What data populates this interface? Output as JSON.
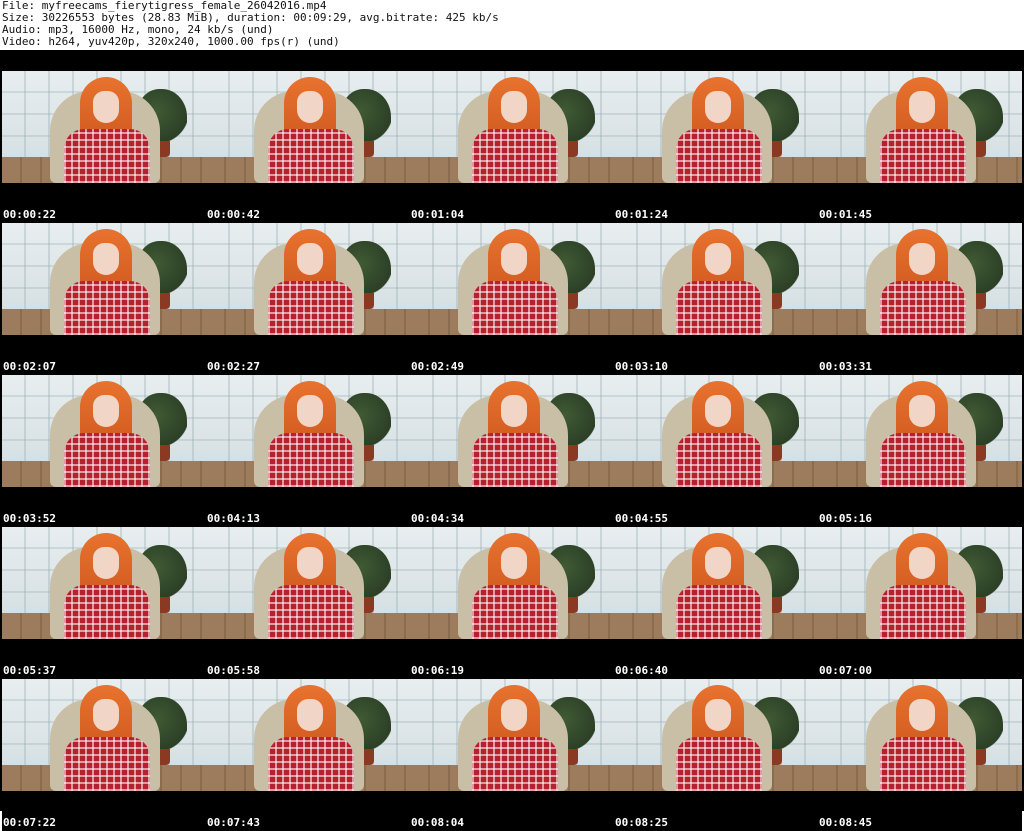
{
  "header": {
    "file": "File: myfreecams_fierytigress_female_26042016.mp4",
    "size": "Size: 30226553 bytes (28.83 MiB), duration: 00:09:29, avg.bitrate: 425 kb/s",
    "audio": "Audio: mp3, 16000 Hz, mono, 24 kb/s (und)",
    "video": "Video: h264, yuv420p, 320x240, 1000.00 fps(r) (und)"
  },
  "thumbnails": [
    {
      "timestamp": "00:00:22"
    },
    {
      "timestamp": "00:00:42"
    },
    {
      "timestamp": "00:01:04"
    },
    {
      "timestamp": "00:01:24"
    },
    {
      "timestamp": "00:01:45"
    },
    {
      "timestamp": "00:02:07"
    },
    {
      "timestamp": "00:02:27"
    },
    {
      "timestamp": "00:02:49"
    },
    {
      "timestamp": "00:03:10"
    },
    {
      "timestamp": "00:03:31"
    },
    {
      "timestamp": "00:03:52"
    },
    {
      "timestamp": "00:04:13"
    },
    {
      "timestamp": "00:04:34"
    },
    {
      "timestamp": "00:04:55"
    },
    {
      "timestamp": "00:05:16"
    },
    {
      "timestamp": "00:05:37"
    },
    {
      "timestamp": "00:05:58"
    },
    {
      "timestamp": "00:06:19"
    },
    {
      "timestamp": "00:06:40"
    },
    {
      "timestamp": "00:07:00"
    },
    {
      "timestamp": "00:07:22"
    },
    {
      "timestamp": "00:07:43"
    },
    {
      "timestamp": "00:08:04"
    },
    {
      "timestamp": "00:08:25"
    },
    {
      "timestamp": "00:08:45"
    }
  ]
}
